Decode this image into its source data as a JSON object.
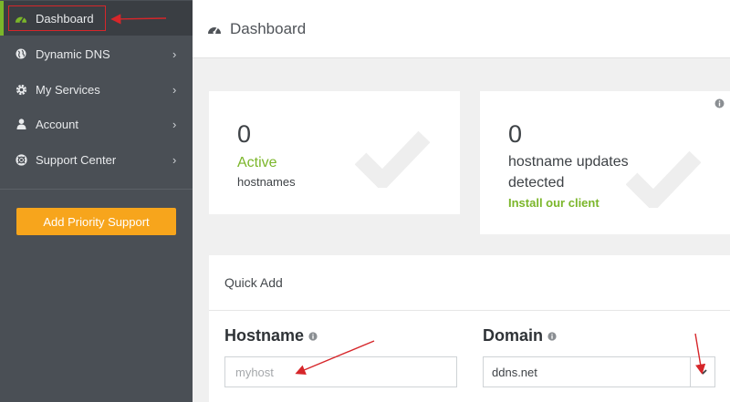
{
  "sidebar": {
    "items": [
      {
        "label": "Dashboard",
        "icon": "dashboard-icon"
      },
      {
        "label": "Dynamic DNS",
        "icon": "globe-icon"
      },
      {
        "label": "My Services",
        "icon": "gear-icon"
      },
      {
        "label": "Account",
        "icon": "user-icon"
      },
      {
        "label": "Support Center",
        "icon": "lifebuoy-icon"
      }
    ],
    "priority_button": "Add Priority Support"
  },
  "header": {
    "title": "Dashboard",
    "icon": "dashboard-icon"
  },
  "cards": {
    "active": {
      "count": "0",
      "status": "Active",
      "label": "hostnames"
    },
    "updates": {
      "count": "0",
      "label": "hostname updates detected",
      "link": "Install our client"
    }
  },
  "quick_add": {
    "title": "Quick Add",
    "hostname": {
      "label": "Hostname",
      "placeholder": "myhost"
    },
    "domain": {
      "label": "Domain",
      "value": "ddns.net"
    }
  },
  "colors": {
    "sidebar_bg": "#4a4f55",
    "accent_green": "#7bb62a",
    "priority_orange": "#f7a51c",
    "annotation_red": "#d6262a"
  }
}
